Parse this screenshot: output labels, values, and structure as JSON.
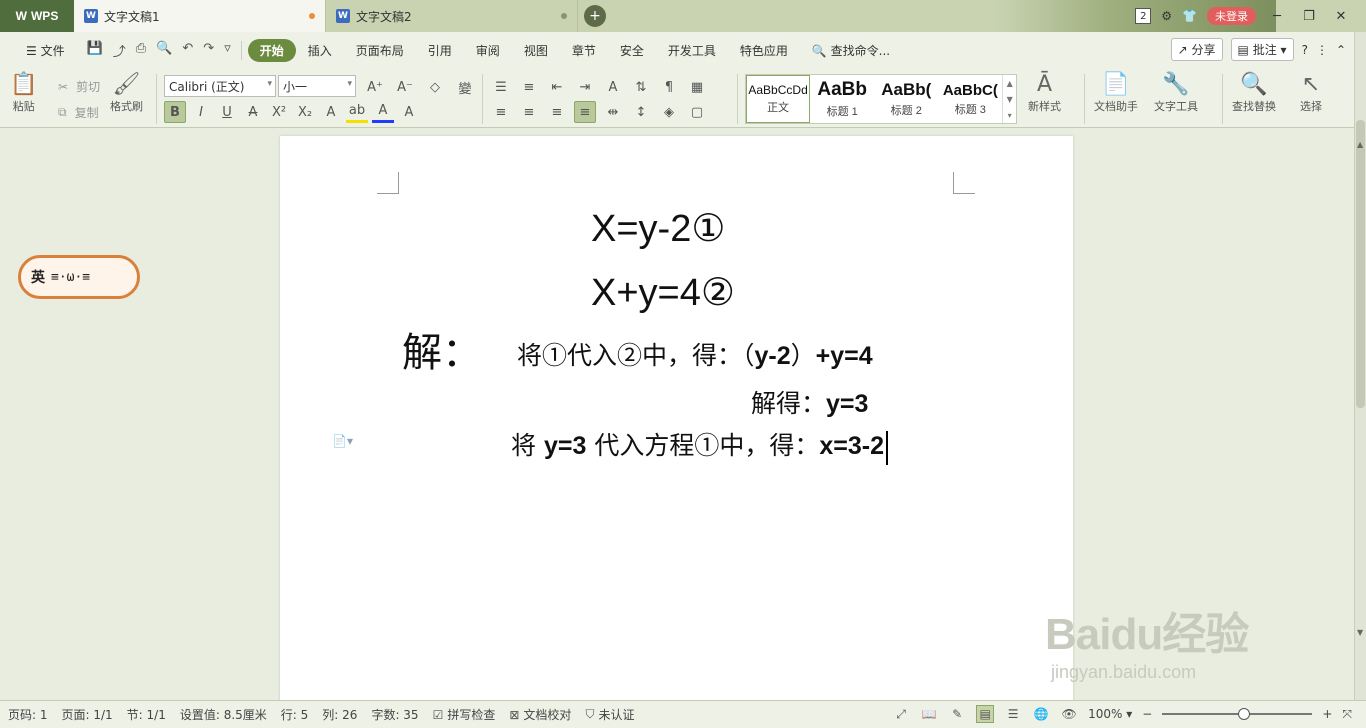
{
  "titlebar": {
    "app_name": "WPS",
    "tabs": [
      {
        "label": "文字文稿1",
        "active": true
      },
      {
        "label": "文字文稿2",
        "active": false
      }
    ],
    "new_tab_symbol": "+",
    "notification_count": "2",
    "login_label": "未登录"
  },
  "menubar": {
    "file_label": "文件",
    "items": [
      "开始",
      "插入",
      "页面布局",
      "引用",
      "审阅",
      "视图",
      "章节",
      "安全",
      "开发工具",
      "特色应用"
    ],
    "search_label": "查找命令...",
    "share_label": "分享",
    "comment_label": "批注"
  },
  "ribbon": {
    "paste_label": "粘贴",
    "cut_label": "剪切",
    "copy_label": "复制",
    "format_painter_label": "格式刷",
    "font_name": "Calibri (正文)",
    "font_size": "小一",
    "styles": [
      {
        "sample": "AaBbCcDd",
        "label": "正文"
      },
      {
        "sample": "AaBb",
        "label": "标题 1"
      },
      {
        "sample": "AaBb(",
        "label": "标题 2"
      },
      {
        "sample": "AaBbC(",
        "label": "标题 3"
      }
    ],
    "new_style_label": "新样式",
    "doc_assistant_label": "文档助手",
    "text_tools_label": "文字工具",
    "find_replace_label": "查找替换",
    "select_label": "选择"
  },
  "document": {
    "eq1": "X=y-2①",
    "eq2": "X+y=4②",
    "solution_head": "解：",
    "line1_a": "将①代入②中，得：（",
    "line1_b": "y-2",
    "line1_c": "）",
    "line1_d": "+y=4",
    "line2_a": "解得：",
    "line2_b": "y=3",
    "line3_a": "将",
    "line3_b": "y=3",
    "line3_c": "代入方程①中，得：",
    "line3_d": "x=3-2"
  },
  "floating_ball": {
    "char": "英",
    "face": "≡·ω·≡"
  },
  "watermark": {
    "text": "Baidu经验",
    "url": "jingyan.baidu.com"
  },
  "statusbar": {
    "page_no": "页码: 1",
    "pages": "页面: 1/1",
    "section": "节: 1/1",
    "setting": "设置值: 8.5厘米",
    "row": "行: 5",
    "col": "列: 26",
    "word_count": "字数: 35",
    "spell_check": "拼写检查",
    "doc_proof": "文档校对",
    "cert": "未认证",
    "zoom": "100%"
  }
}
